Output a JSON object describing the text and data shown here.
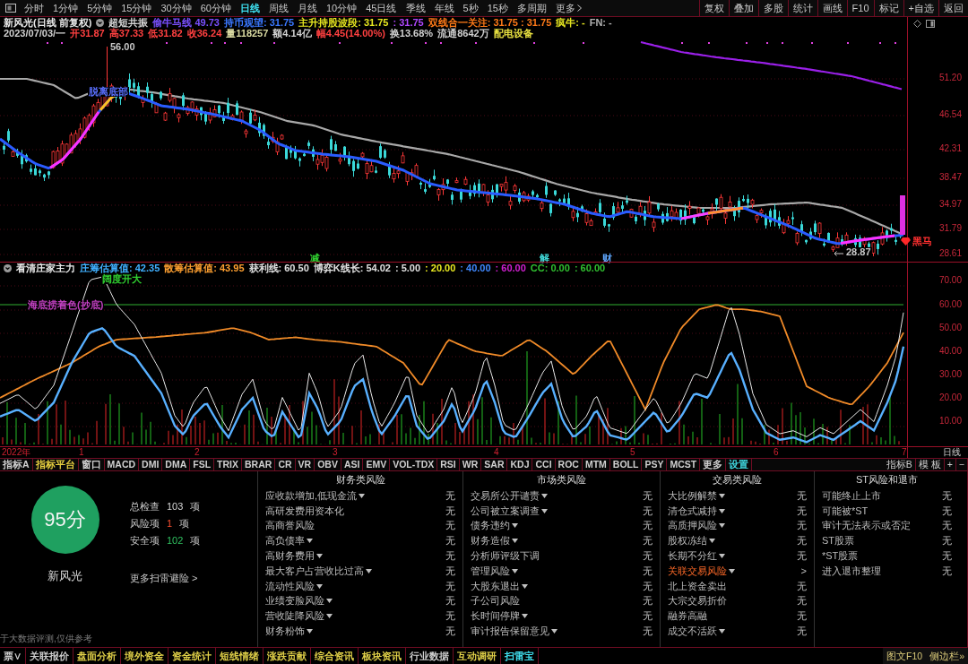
{
  "toolbar": {
    "periods": [
      {
        "label": "分时",
        "selected": false
      },
      {
        "label": "1分钟",
        "selected": false
      },
      {
        "label": "5分钟",
        "selected": false
      },
      {
        "label": "15分钟",
        "selected": false
      },
      {
        "label": "30分钟",
        "selected": false
      },
      {
        "label": "60分钟",
        "selected": false
      },
      {
        "label": "日线",
        "selected": true
      },
      {
        "label": "周线",
        "selected": false
      },
      {
        "label": "月线",
        "selected": false
      },
      {
        "label": "10分钟",
        "selected": false
      },
      {
        "label": "45日线",
        "selected": false
      },
      {
        "label": "季线",
        "selected": false
      },
      {
        "label": "年线",
        "selected": false
      },
      {
        "label": "5秒",
        "selected": false
      },
      {
        "label": "15秒",
        "selected": false
      },
      {
        "label": "多周期",
        "selected": false
      },
      {
        "label": "更多",
        "selected": false
      }
    ],
    "actions": [
      "复权",
      "叠加",
      "多股",
      "统计",
      "画线",
      "F10",
      "标记",
      "+自选",
      "返回"
    ]
  },
  "price_chart": {
    "title": "新风光(日线 前复权)",
    "indicator_values": [
      {
        "text": "超短共振",
        "color": "#d8d8d8"
      },
      {
        "text": "偷牛马线 49.73",
        "color": "#7a50ff"
      },
      {
        "text": "持币观望: 31.75",
        "color": "#3a78ff"
      },
      {
        "text": "主升持股波段: 31.75",
        "color": "#e8e820"
      },
      {
        "text": ": 31.75",
        "color": "#b048ff"
      },
      {
        "text": "双线合一关注: 31.75 : 31.75",
        "color": "#ff7a18"
      },
      {
        "text": "疯牛: -",
        "color": "#e0e020"
      },
      {
        "text": "FN: -",
        "color": "#b0b0b0"
      }
    ],
    "quote": [
      {
        "text": "2023/07/03/一",
        "color": "#d0d0d0"
      },
      {
        "text": "开31.87",
        "color": "#ff4040"
      },
      {
        "text": "高37.33",
        "color": "#ff4040"
      },
      {
        "text": "低31.82",
        "color": "#ff4040"
      },
      {
        "text": "收36.24",
        "color": "#ff4040"
      },
      {
        "text": "量118257",
        "color": "#d8d8a0"
      },
      {
        "text": "额4.14亿",
        "color": "#d0d0d0"
      },
      {
        "text": "幅4.45(14.00%)",
        "color": "#ff4040"
      },
      {
        "text": "换13.68%",
        "color": "#d0d0d0"
      },
      {
        "text": "流通8642万",
        "color": "#d0d0d0"
      },
      {
        "text": "配电设备",
        "color": "#e8e040"
      }
    ],
    "price_axis": [
      "51.20",
      "46.54",
      "42.31",
      "38.47",
      "34.97",
      "31.79",
      "28.61"
    ],
    "annotations": [
      {
        "text": "56.00",
        "color": "#c8c8c8"
      },
      {
        "text": "脱离底部",
        "color": "#5a70ff"
      },
      {
        "text": "减",
        "color": "#30d030"
      },
      {
        "text": "解",
        "color": "#40d8d8"
      },
      {
        "text": "财",
        "color": "#60a8ff"
      },
      {
        "text": "28.87",
        "color": "#c8c8c8"
      },
      {
        "text": "黑马",
        "color": "#ff3030"
      }
    ]
  },
  "indicator_chart": {
    "title": "看清庄家主力",
    "values": [
      {
        "text": "庄筹估算值: 42.35",
        "color": "#40b0ff"
      },
      {
        "text": "散筹估算值: 43.95",
        "color": "#ffa030"
      },
      {
        "text": "获利线: 60.50",
        "color": "#e0e0e0"
      },
      {
        "text": "博弈K线长: 54.02",
        "color": "#e0e0e0"
      },
      {
        "text": ": 5.00",
        "color": "#e0e0e0"
      },
      {
        "text": ": 20.00",
        "color": "#e8e820"
      },
      {
        "text": ": 40.00",
        "color": "#4088ff"
      },
      {
        "text": ": 60.00",
        "color": "#d020d0"
      },
      {
        "text": "CC: 0.00",
        "color": "#30c030"
      },
      {
        "text": ": 60.00",
        "color": "#30c030"
      }
    ],
    "axis": [
      "70.00",
      "60.00",
      "50.00",
      "40.00",
      "30.00",
      "20.00",
      "10.00"
    ],
    "annotations": [
      {
        "text": "阔度开大",
        "color": "#30d030"
      },
      {
        "text": "海底捞着色(抄底)",
        "color": "#c040c0"
      }
    ]
  },
  "x_axis": {
    "labels": [
      "2022年",
      "1",
      "2",
      "3",
      "4",
      "5",
      "6",
      "7"
    ],
    "period": "日线"
  },
  "indicator_tabs": {
    "left": [
      {
        "label": "指标A",
        "color": "#d0d0d0"
      },
      {
        "label": "指标平台",
        "color": "#e8d040"
      },
      {
        "label": "窗口",
        "color": "#d0d0d0"
      },
      {
        "label": "MACD",
        "color": "#d0d0d0"
      },
      {
        "label": "DMI",
        "color": "#d0d0d0"
      },
      {
        "label": "DMA",
        "color": "#d0d0d0"
      },
      {
        "label": "FSL",
        "color": "#d0d0d0"
      },
      {
        "label": "TRIX",
        "color": "#d0d0d0"
      },
      {
        "label": "BRAR",
        "color": "#d0d0d0"
      },
      {
        "label": "CR",
        "color": "#d0d0d0"
      },
      {
        "label": "VR",
        "color": "#d0d0d0"
      },
      {
        "label": "OBV",
        "color": "#d0d0d0"
      },
      {
        "label": "ASI",
        "color": "#d0d0d0"
      },
      {
        "label": "EMV",
        "color": "#d0d0d0"
      },
      {
        "label": "VOL-TDX",
        "color": "#d0d0d0"
      },
      {
        "label": "RSI",
        "color": "#d0d0d0"
      },
      {
        "label": "WR",
        "color": "#d0d0d0"
      },
      {
        "label": "SAR",
        "color": "#d0d0d0"
      },
      {
        "label": "KDJ",
        "color": "#d0d0d0"
      },
      {
        "label": "CCI",
        "color": "#d0d0d0"
      },
      {
        "label": "ROC",
        "color": "#d0d0d0"
      },
      {
        "label": "MTM",
        "color": "#d0d0d0"
      },
      {
        "label": "BOLL",
        "color": "#d0d0d0"
      },
      {
        "label": "PSY",
        "color": "#d0d0d0"
      },
      {
        "label": "MCST",
        "color": "#d0d0d0"
      },
      {
        "label": "更多",
        "color": "#d0d0d0"
      },
      {
        "label": "设置",
        "color": "#40d8e0"
      }
    ],
    "right": [
      "指标B",
      "模 板",
      "+",
      "−"
    ]
  },
  "risk": {
    "score": "95分",
    "stock": "新风光",
    "stats": [
      {
        "label": "总检查",
        "value": "103",
        "unit": "项",
        "kind": "total"
      },
      {
        "label": "风险项",
        "value": "1",
        "unit": "项",
        "kind": "risk"
      },
      {
        "label": "安全项",
        "value": "102",
        "unit": "项",
        "kind": "safe"
      }
    ],
    "more_link": "更多扫雷避险 >",
    "footnote": "于大数据评测,仅供参考",
    "categories": [
      {
        "title": "财务类风险",
        "items": [
          {
            "label": "应收款增加,低现金流",
            "dropdown": true,
            "flagged": false,
            "result": "无"
          },
          {
            "label": "高研发费用资本化",
            "dropdown": false,
            "flagged": false,
            "result": "无"
          },
          {
            "label": "高商誉风险",
            "dropdown": false,
            "flagged": false,
            "result": "无"
          },
          {
            "label": "高负债率",
            "dropdown": true,
            "flagged": false,
            "result": "无"
          },
          {
            "label": "高财务费用",
            "dropdown": true,
            "flagged": false,
            "result": "无"
          },
          {
            "label": "最大客户占营收比过高",
            "dropdown": true,
            "flagged": false,
            "result": "无"
          },
          {
            "label": "流动性风险",
            "dropdown": true,
            "flagged": false,
            "result": "无"
          },
          {
            "label": "业绩变脸风险",
            "dropdown": true,
            "flagged": false,
            "result": "无"
          },
          {
            "label": "营收陡降风险",
            "dropdown": true,
            "flagged": false,
            "result": "无"
          },
          {
            "label": "财务粉饰",
            "dropdown": true,
            "flagged": false,
            "result": "无"
          }
        ]
      },
      {
        "title": "市场类风险",
        "items": [
          {
            "label": "交易所公开谴责",
            "dropdown": true,
            "flagged": false,
            "result": "无"
          },
          {
            "label": "公司被立案调查",
            "dropdown": true,
            "flagged": false,
            "result": "无"
          },
          {
            "label": "债务违约",
            "dropdown": true,
            "flagged": false,
            "result": "无"
          },
          {
            "label": "财务造假",
            "dropdown": true,
            "flagged": false,
            "result": "无"
          },
          {
            "label": "分析师评级下调",
            "dropdown": false,
            "flagged": false,
            "result": "无"
          },
          {
            "label": "管理风险",
            "dropdown": true,
            "flagged": false,
            "result": "无"
          },
          {
            "label": "大股东退出",
            "dropdown": true,
            "flagged": false,
            "result": "无"
          },
          {
            "label": "子公司风险",
            "dropdown": false,
            "flagged": false,
            "result": "无"
          },
          {
            "label": "长时间停牌",
            "dropdown": true,
            "flagged": false,
            "result": "无"
          },
          {
            "label": "审计报告保留意见",
            "dropdown": true,
            "flagged": false,
            "result": "无"
          }
        ]
      },
      {
        "title": "交易类风险",
        "items": [
          {
            "label": "大比例解禁",
            "dropdown": true,
            "flagged": false,
            "result": "无"
          },
          {
            "label": "清仓式减持",
            "dropdown": true,
            "flagged": false,
            "result": "无"
          },
          {
            "label": "高质押风险",
            "dropdown": true,
            "flagged": false,
            "result": "无"
          },
          {
            "label": "股权冻结",
            "dropdown": true,
            "flagged": false,
            "result": "无"
          },
          {
            "label": "长期不分红",
            "dropdown": true,
            "flagged": false,
            "result": "无"
          },
          {
            "label": "关联交易风险",
            "dropdown": true,
            "flagged": true,
            "result": ">"
          },
          {
            "label": "北上资金卖出",
            "dropdown": false,
            "flagged": false,
            "result": "无"
          },
          {
            "label": "大宗交易折价",
            "dropdown": false,
            "flagged": false,
            "result": "无"
          },
          {
            "label": "融券高融",
            "dropdown": false,
            "flagged": false,
            "result": "无"
          },
          {
            "label": "成交不活跃",
            "dropdown": true,
            "flagged": false,
            "result": "无"
          }
        ]
      },
      {
        "title": "ST风险和退市",
        "items": [
          {
            "label": "可能终止上市",
            "dropdown": false,
            "flagged": false,
            "result": "无"
          },
          {
            "label": "可能被*ST",
            "dropdown": false,
            "flagged": false,
            "result": "无"
          },
          {
            "label": "审计无法表示或否定",
            "dropdown": false,
            "flagged": false,
            "result": "无"
          },
          {
            "label": "ST股票",
            "dropdown": false,
            "flagged": false,
            "result": "无"
          },
          {
            "label": "*ST股票",
            "dropdown": false,
            "flagged": false,
            "result": "无"
          },
          {
            "label": "进入退市整理",
            "dropdown": false,
            "flagged": false,
            "result": "无"
          }
        ]
      }
    ]
  },
  "bottom_bar": {
    "tabs": [
      {
        "label": "票∨",
        "selected": false,
        "color": "#d0d0d0"
      },
      {
        "label": "关联报价",
        "selected": false,
        "color": "#d0d0d0"
      },
      {
        "label": "盘面分析",
        "selected": false,
        "color": "#e0d048"
      },
      {
        "label": "境外资金",
        "selected": false,
        "color": "#e0d048"
      },
      {
        "label": "资金统计",
        "selected": false,
        "color": "#e0d048"
      },
      {
        "label": "短线情绪",
        "selected": false,
        "color": "#e0d048"
      },
      {
        "label": "涨跌贡献",
        "selected": false,
        "color": "#e0d048"
      },
      {
        "label": "综合资讯",
        "selected": false,
        "color": "#e0d048"
      },
      {
        "label": "板块资讯",
        "selected": false,
        "color": "#e0d048"
      },
      {
        "label": "行业数据",
        "selected": false,
        "color": "#d0d0d0"
      },
      {
        "label": "互动调研",
        "selected": false,
        "color": "#e0d048"
      },
      {
        "label": "扫雷宝",
        "selected": true
      }
    ],
    "side": [
      "图文F10",
      "侧边栏»"
    ]
  }
}
